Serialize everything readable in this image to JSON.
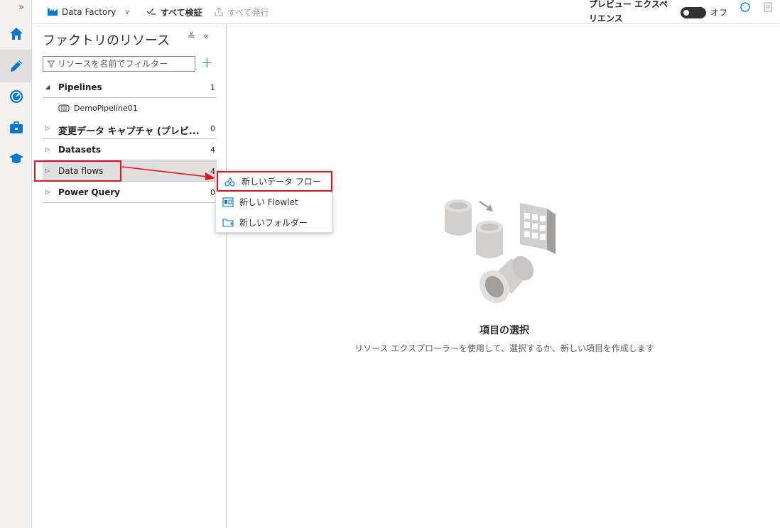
{
  "rail": {
    "expand_glyph": "»",
    "items": [
      {
        "name": "home-icon"
      },
      {
        "name": "author-pencil-icon",
        "active": true
      },
      {
        "name": "monitor-gauge-icon"
      },
      {
        "name": "manage-toolbox-icon"
      },
      {
        "name": "learning-center-icon"
      }
    ]
  },
  "toolbar": {
    "factory_label": "Data Factory",
    "validate_label": "すべて検証",
    "publish_label": "すべて発行",
    "preview_label": "プレビュー エクスペリエンス",
    "toggle_state": "オフ"
  },
  "panel": {
    "title": "ファクトリのリソース",
    "collapse_all_glyph": "≚",
    "hide_glyph": "«",
    "filter_placeholder": "リソースを名前でフィルター",
    "add_glyph": "+"
  },
  "tree": {
    "pipelines": {
      "label": "Pipelines",
      "count": "1"
    },
    "pipeline_child": {
      "label": "DemoPipeline01"
    },
    "cdc": {
      "label": "変更データ キャプチャ (プレビ...",
      "count": "0"
    },
    "datasets": {
      "label": "Datasets",
      "count": "4"
    },
    "dataflows": {
      "label": "Data flows",
      "count": "4"
    },
    "powerquery": {
      "label": "Power Query",
      "count": "0"
    }
  },
  "menu": {
    "items": [
      {
        "label": "新しいデータ フロー",
        "icon": "dataflow-icon"
      },
      {
        "label": "新しい Flowlet",
        "icon": "flowlet-icon"
      },
      {
        "label": "新しいフォルダー",
        "icon": "folder-icon"
      }
    ]
  },
  "empty_state": {
    "title": "項目の選択",
    "subtitle": "リソース エクスプローラーを使用して、選択するか、新しい項目を作成します"
  },
  "colors": {
    "accent": "#0078d4",
    "highlight_red": "#e8111f"
  }
}
